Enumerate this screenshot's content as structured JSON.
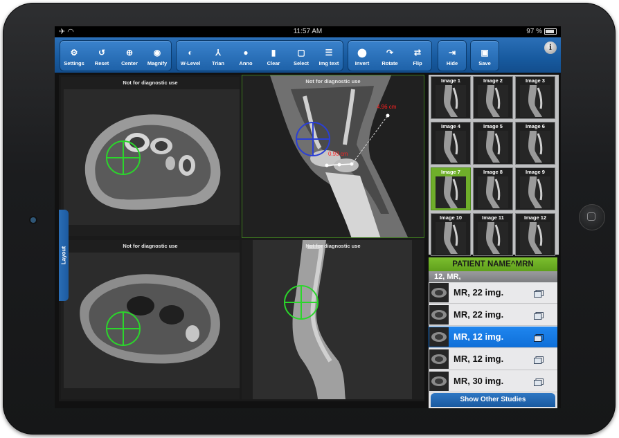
{
  "status": {
    "time": "11:57 AM",
    "battery": "97 %"
  },
  "toolbar": {
    "g1": [
      {
        "label": "Settings",
        "icon": "gear-icon",
        "glyph": "⚙"
      },
      {
        "label": "Reset",
        "icon": "reset-icon",
        "glyph": "↺"
      },
      {
        "label": "Center",
        "icon": "crosshair-icon",
        "glyph": "⊕"
      },
      {
        "label": "Magnify",
        "icon": "eye-icon",
        "glyph": "◉"
      }
    ],
    "g2": [
      {
        "label": "W-Level",
        "icon": "contrast-icon",
        "glyph": "◐"
      },
      {
        "label": "Trian",
        "icon": "triangulate-icon",
        "glyph": "⅄"
      },
      {
        "label": "Anno",
        "icon": "speech-bubble-icon",
        "glyph": "●"
      },
      {
        "label": "Clear",
        "icon": "trash-icon",
        "glyph": "▮"
      },
      {
        "label": "Select",
        "icon": "select-square-icon",
        "glyph": "▢"
      },
      {
        "label": "Img text",
        "icon": "text-lines-icon",
        "glyph": "☰"
      }
    ],
    "g3": [
      {
        "label": "Invert",
        "icon": "invert-icon",
        "glyph": "⬤"
      },
      {
        "label": "Rotate",
        "icon": "rotate-icon",
        "glyph": "↷"
      },
      {
        "label": "Flip",
        "icon": "flip-icon",
        "glyph": "⇄"
      }
    ],
    "hide": {
      "label": "Hide",
      "icon": "hide-arrow-icon",
      "glyph": "⇥"
    },
    "save": {
      "label": "Save",
      "icon": "save-disk-icon",
      "glyph": "▣"
    },
    "info_glyph": "i"
  },
  "viewer": {
    "layout_tab": "Layout",
    "panes": [
      {
        "label": "Not for diagnostic use"
      },
      {
        "label": "Not for diagnostic use",
        "measure1": "4.96 cm",
        "measure2": "0.93 cm"
      },
      {
        "label": "Not for diagnostic use"
      },
      {
        "label": "Not for diagnostic use"
      }
    ]
  },
  "thumbnails": [
    "Image 1",
    "Image 2",
    "Image 3",
    "Image 4",
    "Image 5",
    "Image 6",
    "Image 7",
    "Image 8",
    "Image 9",
    "Image 10",
    "Image 11",
    "Image 12"
  ],
  "selected_thumbnail": "Image 7",
  "studies": {
    "header": "PATIENT NAME^MRN",
    "subheader": "12, MR,",
    "items": [
      "MR, 22 img.",
      "MR, 22 img.",
      "MR, 12 img.",
      "MR, 12 img.",
      "MR, 30 img."
    ],
    "selected": 2,
    "show_other": "Show Other Studies"
  },
  "colors": {
    "accent": "#1e62a9",
    "selection": "#6fae2a",
    "row_selected": "#0f6fd8",
    "crosshair": "#2bd62b",
    "crosshair_blue": "#2a3fd6",
    "measure": "#ff2020"
  }
}
